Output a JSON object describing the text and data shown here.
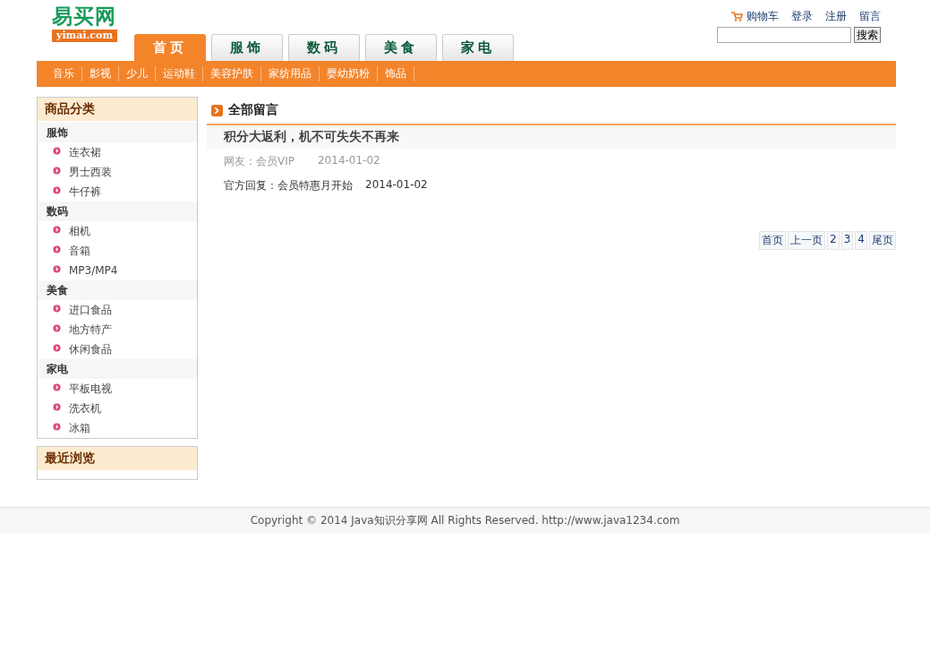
{
  "logo": {
    "name": "易买网",
    "domain": "yimai.com"
  },
  "top_links": [
    {
      "label": "购物车",
      "kind": "cart"
    },
    {
      "label": "登录",
      "kind": "link"
    },
    {
      "label": "注册",
      "kind": "link"
    },
    {
      "label": "留言",
      "kind": "link"
    }
  ],
  "search": {
    "button": "搜索"
  },
  "tabs": [
    {
      "label": "首页",
      "selected": true
    },
    {
      "label": "服饰",
      "selected": false
    },
    {
      "label": "数码",
      "selected": false
    },
    {
      "label": "美食",
      "selected": false
    },
    {
      "label": "家电",
      "selected": false
    }
  ],
  "subnav": [
    "音乐",
    "影视",
    "少儿",
    "运动鞋",
    "美容护肤",
    "家纺用品",
    "婴幼奶粉",
    "饰品"
  ],
  "categories": {
    "title": "商品分类",
    "groups": [
      {
        "name": "服饰",
        "items": [
          "连衣裙",
          "男士西装",
          "牛仔裤"
        ]
      },
      {
        "name": "数码",
        "items": [
          "相机",
          "音箱",
          "MP3/MP4"
        ]
      },
      {
        "name": "美食",
        "items": [
          "进口食品",
          "地方特产",
          "休闲食品"
        ]
      },
      {
        "name": "家电",
        "items": [
          "平板电视",
          "洗衣机",
          "冰箱"
        ]
      }
    ]
  },
  "recent": {
    "title": "最近浏览"
  },
  "messages": {
    "title": "全部留言",
    "items": [
      {
        "subject": "积分大返利，机不可失失不再来",
        "author": "网友：会员VIP",
        "date": "2014-01-02",
        "reply": "官方回复：会员特惠月开始",
        "reply_date": "2014-01-02"
      }
    ]
  },
  "pagination": [
    "首页",
    "上一页",
    "2",
    "3",
    "4",
    "尾页"
  ],
  "footer": "Copyright © 2014 Java知识分享网 All Rights Reserved. http://www.java1234.com"
}
